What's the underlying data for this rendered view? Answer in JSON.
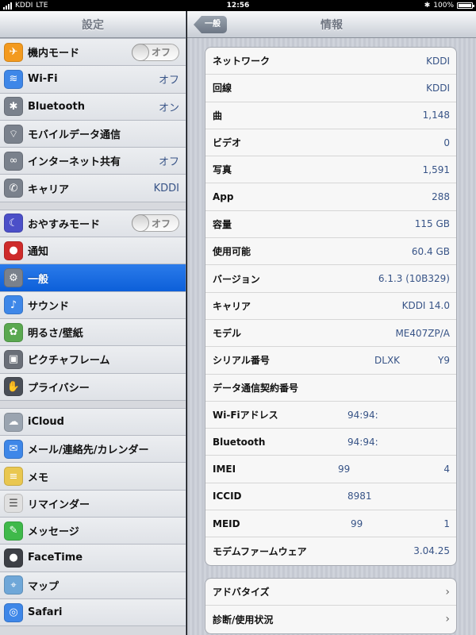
{
  "status": {
    "carrier": "KDDI",
    "network": "LTE",
    "time": "12:56",
    "battery": "100%"
  },
  "master": {
    "title": "設定",
    "groups": [
      [
        {
          "label": "機内モード",
          "toggle": "オフ",
          "icon": "airplane-icon",
          "color": "#f39a1f"
        },
        {
          "label": "Wi-Fi",
          "value": "オフ",
          "icon": "wifi-icon",
          "color": "#3e87e8"
        },
        {
          "label": "Bluetooth",
          "value": "オン",
          "icon": "bluetooth-icon",
          "color": "#7a818c"
        },
        {
          "label": "モバイルデータ通信",
          "icon": "cellular-icon",
          "color": "#7a818c"
        },
        {
          "label": "インターネット共有",
          "value": "オフ",
          "icon": "link-icon",
          "color": "#7a818c"
        },
        {
          "label": "キャリア",
          "value": "KDDI",
          "icon": "phone-icon",
          "color": "#7a818c"
        }
      ],
      [
        {
          "label": "おやすみモード",
          "toggle": "オフ",
          "icon": "moon-icon",
          "color": "#4b4fc8"
        },
        {
          "label": "通知",
          "icon": "notification-icon",
          "color": "#ce2b2b"
        },
        {
          "label": "一般",
          "icon": "gear-icon",
          "color": "#7a818c",
          "selected": true
        },
        {
          "label": "サウンド",
          "icon": "sound-icon",
          "color": "#3e87e8"
        },
        {
          "label": "明るさ/壁紙",
          "icon": "flower-icon",
          "color": "#5aa850"
        },
        {
          "label": "ピクチャフレーム",
          "icon": "picture-frame-icon",
          "color": "#6a6f78"
        },
        {
          "label": "プライバシー",
          "icon": "hand-icon",
          "color": "#4a4f58"
        }
      ],
      [
        {
          "label": "iCloud",
          "icon": "cloud-icon",
          "color": "#9aa4b0"
        },
        {
          "label": "メール/連絡先/カレンダー",
          "icon": "mail-icon",
          "color": "#3e87e8"
        },
        {
          "label": "メモ",
          "icon": "notes-icon",
          "color": "#e9c750"
        },
        {
          "label": "リマインダー",
          "icon": "reminders-icon",
          "color": "#e0e0e0"
        },
        {
          "label": "メッセージ",
          "icon": "messages-icon",
          "color": "#3fb94a"
        },
        {
          "label": "FaceTime",
          "icon": "facetime-icon",
          "color": "#3d4046"
        },
        {
          "label": "マップ",
          "icon": "maps-icon",
          "color": "#6fa7d8"
        },
        {
          "label": "Safari",
          "icon": "safari-icon",
          "color": "#3e87e8"
        }
      ]
    ]
  },
  "detail": {
    "back": "一般",
    "title": "情報",
    "rows": [
      {
        "key": "ネットワーク",
        "value": "KDDI"
      },
      {
        "key": "回線",
        "value": "KDDI"
      },
      {
        "key": "曲",
        "value": "1,148"
      },
      {
        "key": "ビデオ",
        "value": "0"
      },
      {
        "key": "写真",
        "value": "1,591"
      },
      {
        "key": "App",
        "value": "288"
      },
      {
        "key": "容量",
        "value": "115 GB"
      },
      {
        "key": "使用可能",
        "value": "60.4 GB"
      },
      {
        "key": "バージョン",
        "value": "6.1.3 (10B329)"
      },
      {
        "key": "キャリア",
        "value": "KDDI 14.0"
      },
      {
        "key": "モデル",
        "value": "ME407ZP/A"
      },
      {
        "key": "シリアル番号",
        "value_a": "DLXK",
        "value_b": "Y9"
      },
      {
        "key": "データ通信契約番号",
        "value": ""
      },
      {
        "key": "Wi-Fiアドレス",
        "value_a": "94:94:",
        "value_b": ""
      },
      {
        "key": "Bluetooth",
        "value_a": "94:94:",
        "value_b": ""
      },
      {
        "key": "IMEI",
        "value_a": "99",
        "value_b": "4"
      },
      {
        "key": "ICCID",
        "value_a": "8981",
        "value_b": ""
      },
      {
        "key": "MEID",
        "value_a": "99",
        "value_b": "1"
      },
      {
        "key": "モデムファームウェア",
        "value": "3.04.25"
      }
    ],
    "links": [
      {
        "label": "アドバタイズ"
      },
      {
        "label": "診断/使用状況"
      }
    ]
  }
}
